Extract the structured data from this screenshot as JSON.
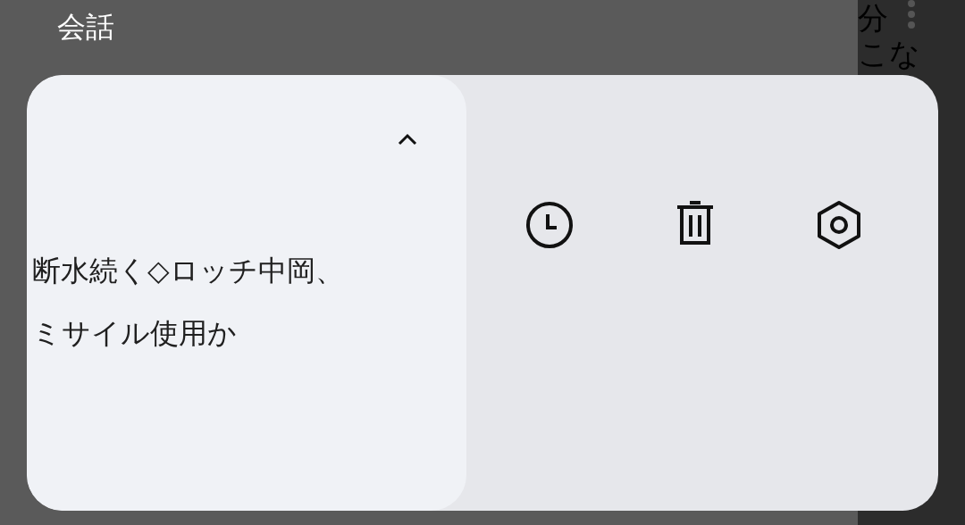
{
  "header": {
    "title": "会話"
  },
  "background": {
    "texts": [
      "分",
      "こな"
    ]
  },
  "panel": {
    "expanded": true,
    "lines": [
      "断水続く◇ロッチ中岡、",
      "ミサイル使用か"
    ]
  }
}
